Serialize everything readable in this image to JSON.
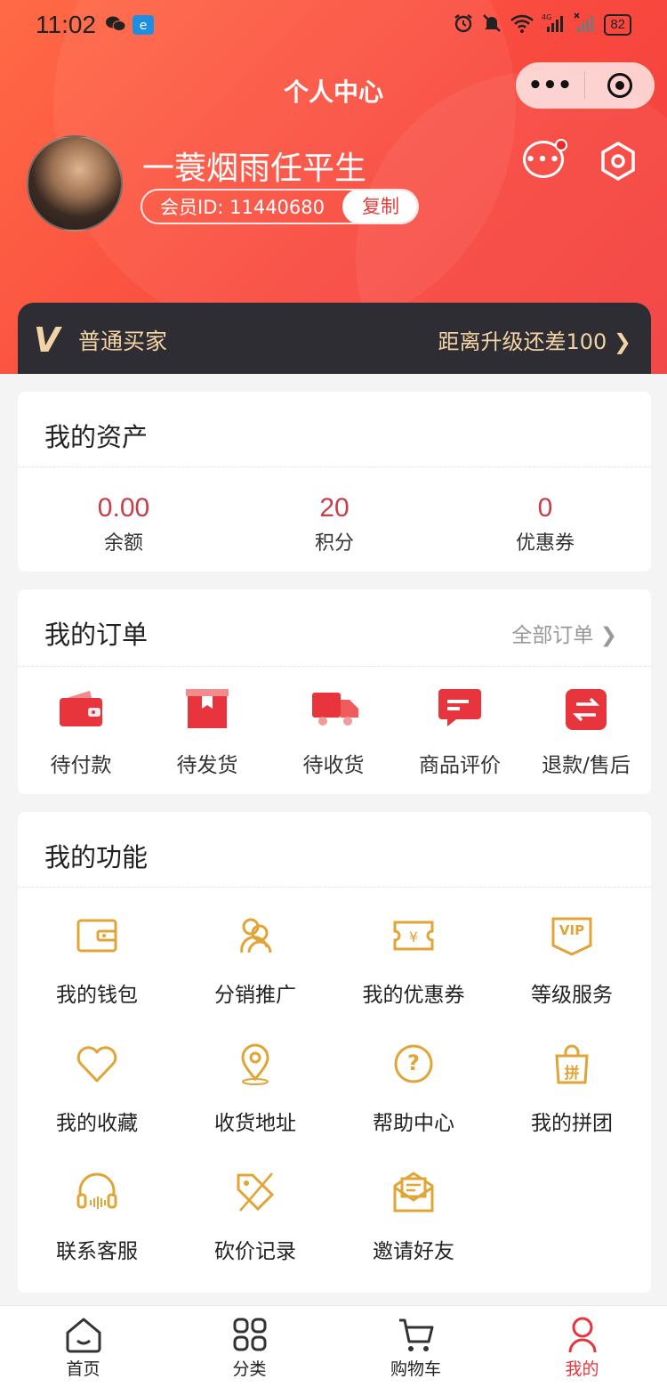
{
  "status_bar": {
    "time": "11:02",
    "battery": "82",
    "network": "4G"
  },
  "nav": {
    "title": "个人中心",
    "more_label": "•••"
  },
  "profile": {
    "username": "一蓑烟雨任平生",
    "member_id": "会员ID: 11440680",
    "copy_label": "复制",
    "message_icon_text": "•••"
  },
  "vip": {
    "badge": "V",
    "level": "普通买家",
    "upgrade": "距离升级还差100 ❯"
  },
  "assets": {
    "title": "我的资产",
    "items": [
      {
        "value": "0.00",
        "label": "余额"
      },
      {
        "value": "20",
        "label": "积分"
      },
      {
        "value": "0",
        "label": "优惠券"
      }
    ]
  },
  "orders": {
    "title": "我的订单",
    "all_label": "全部订单  ❯",
    "items": [
      {
        "label": "待付款",
        "icon": "wallet-icon"
      },
      {
        "label": "待发货",
        "icon": "box-icon"
      },
      {
        "label": "待收货",
        "icon": "truck-icon"
      },
      {
        "label": "商品评价",
        "icon": "comment-icon"
      },
      {
        "label": "退款/售后",
        "icon": "refund-icon"
      }
    ]
  },
  "functions": {
    "title": "我的功能",
    "items": [
      {
        "label": "我的钱包",
        "icon": "wallet-icon"
      },
      {
        "label": "分销推广",
        "icon": "users-icon"
      },
      {
        "label": "我的优惠券",
        "icon": "ticket-icon"
      },
      {
        "label": "等级服务",
        "icon": "vip-icon",
        "glyph": "VIP"
      },
      {
        "label": "我的收藏",
        "icon": "heart-icon"
      },
      {
        "label": "收货地址",
        "icon": "location-icon"
      },
      {
        "label": "帮助中心",
        "icon": "help-icon",
        "glyph": "?"
      },
      {
        "label": "我的拼团",
        "icon": "group-buy-icon",
        "glyph": "拼"
      },
      {
        "label": "联系客服",
        "icon": "headset-icon"
      },
      {
        "label": "砍价记录",
        "icon": "bargain-icon"
      },
      {
        "label": "邀请好友",
        "icon": "invite-icon"
      }
    ]
  },
  "tabbar": {
    "items": [
      {
        "label": "首页",
        "icon": "home-icon"
      },
      {
        "label": "分类",
        "icon": "category-icon"
      },
      {
        "label": "购物车",
        "icon": "cart-icon"
      },
      {
        "label": "我的",
        "icon": "user-icon"
      }
    ]
  },
  "colors": {
    "header_start": "#ff6a45",
    "header_end": "#f23c3c",
    "accent_red": "#e63a37",
    "asset_value": "#c83d4a",
    "gold_icon": "#e1a436",
    "vip_bar_bg": "#2e2d33",
    "vip_text": "#f1d3a5"
  }
}
